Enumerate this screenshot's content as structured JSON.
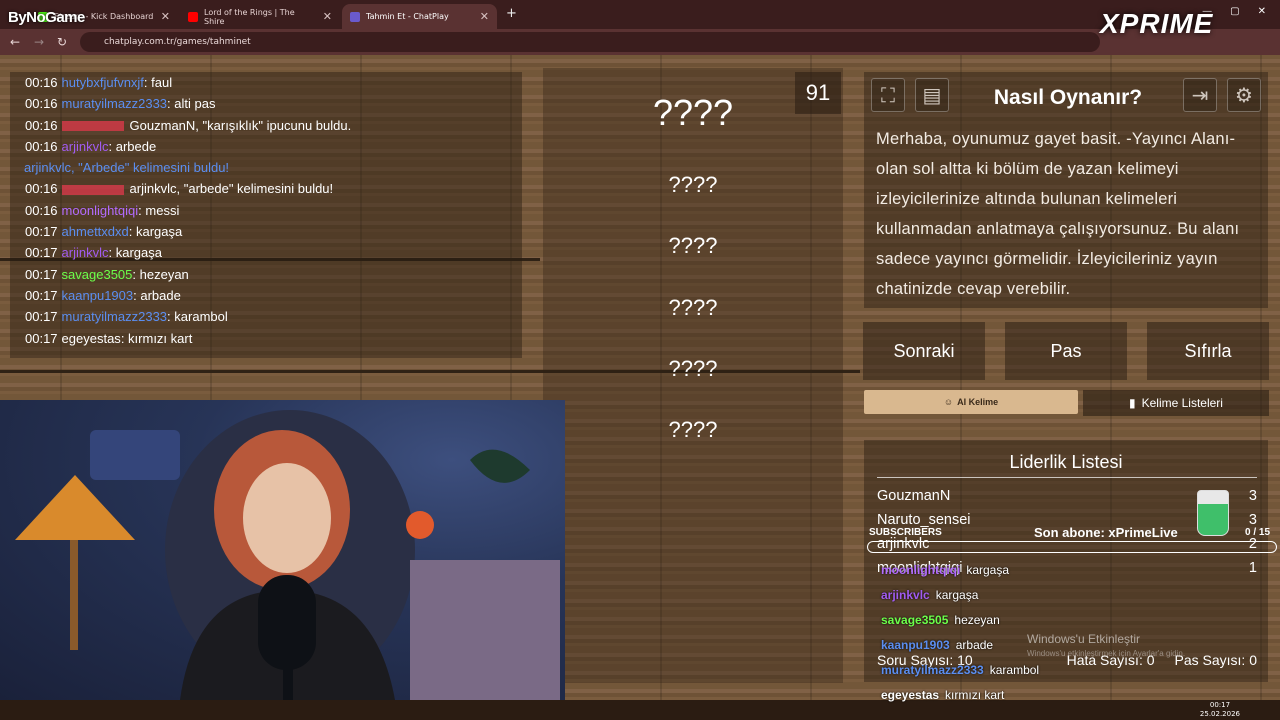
{
  "browser": {
    "tabs": [
      {
        "title": "Stream - Kick Dashboard",
        "color": "#53fc18"
      },
      {
        "title": "Lord of the Rings | The Shire",
        "color": "#ff0000"
      },
      {
        "title": "Tahmin Et - ChatPlay",
        "color": "#6a5acd"
      }
    ],
    "url": "chatplay.com.tr/games/tahminet",
    "new_tab": "+"
  },
  "logos": {
    "bynogame": "ByNoGame",
    "xprime": "XPRIME"
  },
  "chat": [
    {
      "time": "00:16",
      "user": "hutybxfjufvnxjf",
      "user_color": "#5b8ef0",
      "msg": "faul"
    },
    {
      "time": "00:16",
      "user": "muratyilmazz2333",
      "user_color": "#5b8ef0",
      "msg": "alti pas"
    },
    {
      "time": "00:16",
      "user": "",
      "user_color": "",
      "msg": "GouzmanN, \"karışıklık\" ipucunu buldu."
    },
    {
      "time": "00:16",
      "user": "arjinkvlc",
      "user_color": "#a15cf0",
      "msg": "arbede"
    },
    {
      "time": "",
      "user": "",
      "user_color": "",
      "msg": "arjinkvlc, \"Arbede\" kelimesini buldu!",
      "system": true
    },
    {
      "time": "00:16",
      "user": "",
      "user_color": "",
      "msg": "arjinkvlc, \"arbede\" kelimesini buldu!"
    },
    {
      "time": "00:16",
      "user": "moonlightqiqi",
      "user_color": "#b36bff",
      "msg": "messi"
    },
    {
      "time": "00:17",
      "user": "ahmettxdxd",
      "user_color": "#5b8ef0",
      "msg": "kargaşa"
    },
    {
      "time": "00:17",
      "user": "arjinkvlc",
      "user_color": "#a15cf0",
      "msg": "kargaşa"
    },
    {
      "time": "00:17",
      "user": "savage3505",
      "user_color": "#6cff4a",
      "msg": "hezeyan"
    },
    {
      "time": "00:17",
      "user": "kaanpu1903",
      "user_color": "#5b8ef0",
      "msg": "arbade"
    },
    {
      "time": "00:17",
      "user": "muratyilmazz2333",
      "user_color": "#5b8ef0",
      "msg": "karambol"
    },
    {
      "time": "00:17",
      "user": "egeyestas",
      "user_color": "#ffffff",
      "msg": "kırmızı kart"
    }
  ],
  "words": {
    "counter": "91",
    "items": [
      "????",
      "????",
      "????",
      "????",
      "????",
      "????"
    ]
  },
  "howto": {
    "title": "Nasıl Oynanır?",
    "text": "Merhaba, oyunumuz gayet basit. -Yayıncı Alanı-olan sol altta ki bölüm de yazan kelimeyi izleyicilerinize altında bulunan kelimeleri kullanmadan anlatmaya çalışıyorsunuz. Bu alanı sadece yayıncı görmelidir. İzleyicileriniz yayın chatinizde cevap verebilir.",
    "icons": [
      "fullscreen-icon",
      "notes-icon",
      "exit-icon",
      "gear-icon"
    ]
  },
  "buttons": {
    "next": "Sonraki",
    "pass": "Pas",
    "reset": "Sıfırla",
    "ai_word": "AI Kelime",
    "word_lists": "Kelime Listeleri"
  },
  "leaderboard": {
    "title": "Liderlik Listesi",
    "rows": [
      {
        "name": "GouzmanN",
        "score": "3"
      },
      {
        "name": "Naruto_sensei",
        "score": "3"
      },
      {
        "name": "arjinkvlc",
        "score": "2"
      },
      {
        "name": "moonlightqiqi",
        "score": "1"
      }
    ],
    "question_count": "Soru Sayısı: 10",
    "error_count": "Hata Sayısı: 0",
    "pass_count": "Pas Sayısı: 0"
  },
  "overlay": {
    "subscribers_label": "SUBSCRIBERS",
    "last_sub": "Son abone: xPrimeLive",
    "sub_count": "0 / 15",
    "chat": [
      {
        "user": "moonlightqiqi",
        "color": "#b36bff",
        "msg": "kargaşa"
      },
      {
        "user": "arjinkvlc",
        "color": "#a15cf0",
        "msg": "kargaşa"
      },
      {
        "user": "savage3505",
        "color": "#6cff4a",
        "msg": "hezeyan"
      },
      {
        "user": "kaanpu1903",
        "color": "#5b8ef0",
        "msg": "arbade"
      },
      {
        "user": "muratyilmazz2333",
        "color": "#5b8ef0",
        "msg": "karambol"
      },
      {
        "user": "egeyestas",
        "color": "#ffffff",
        "msg": "kırmızı kart"
      }
    ],
    "activate_title": "Windows'u Etkinleştir",
    "activate_sub": "Windows'u etkinleştirmek için Ayarlar'a gidin."
  },
  "taskbar": {
    "time": "00:17",
    "date": "25.02.2026"
  }
}
